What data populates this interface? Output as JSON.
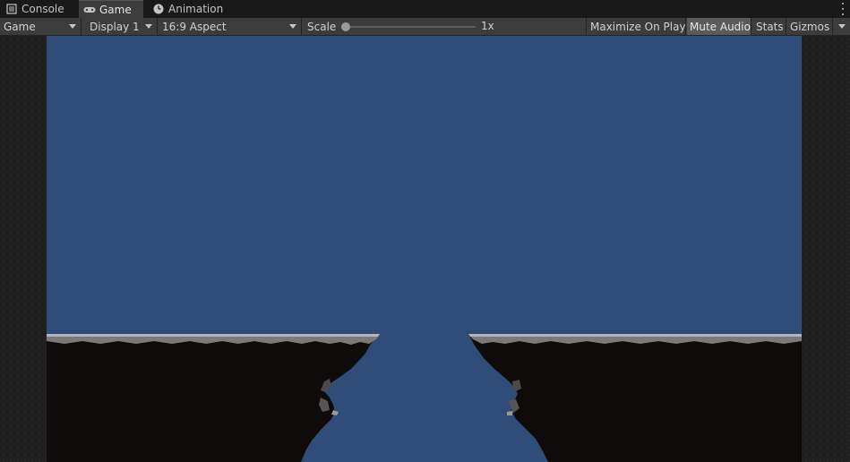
{
  "tabs": [
    {
      "label": "Console",
      "icon": "console-icon"
    },
    {
      "label": "Game",
      "icon": "gamepad-icon"
    },
    {
      "label": "Animation",
      "icon": "animation-clock-icon"
    }
  ],
  "toolbar": {
    "view_dropdown": "Game",
    "display_dropdown": "Display 1",
    "aspect_dropdown": "16:9 Aspect",
    "scale_label": "Scale",
    "scale_value_label": "1x",
    "scale_value": 1,
    "maximize_label": "Maximize On Play",
    "mute_label": "Mute Audio",
    "stats_label": "Stats",
    "gizmos_label": "Gizmos"
  },
  "colors": {
    "sky": "#304d7a",
    "cliff_fill": "#0e0b0a",
    "cliff_rock": "#8a8a8a",
    "editor_bg": "#191919",
    "toolbar_bg": "#3c3c3c"
  }
}
